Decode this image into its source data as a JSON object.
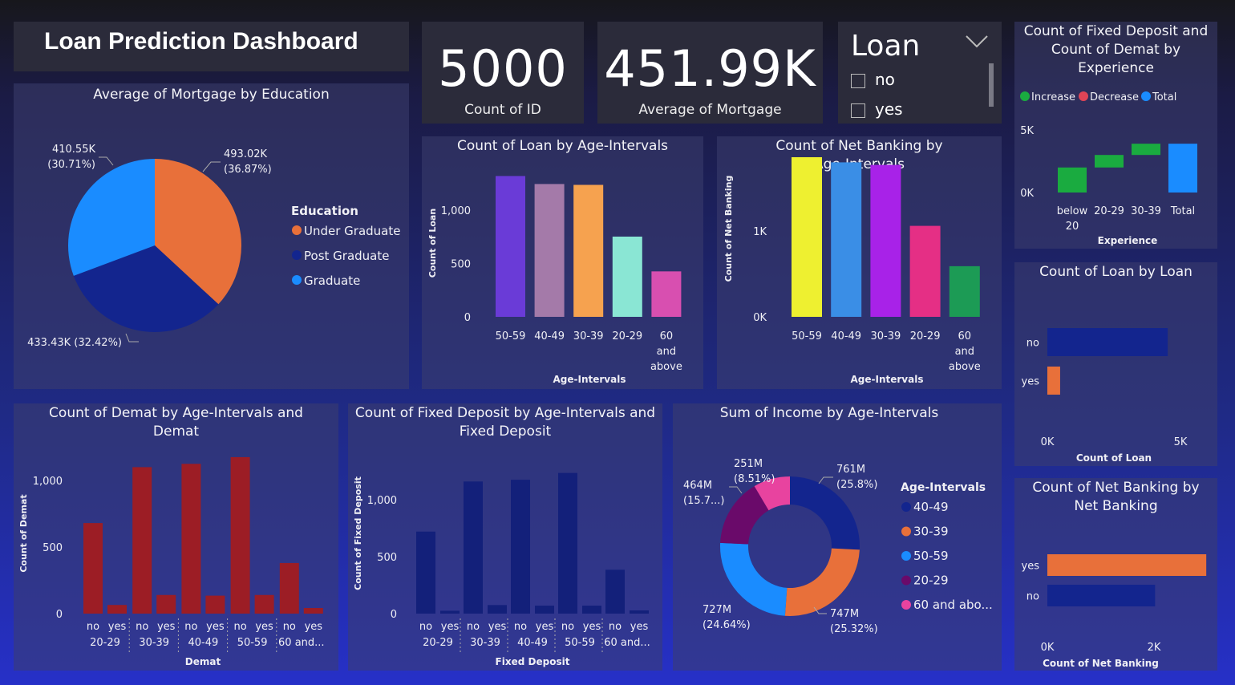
{
  "title": "Loan Prediction Dashboard",
  "cards": [
    {
      "value": "5000",
      "label": "Count of ID"
    },
    {
      "value": "451.99K",
      "label": "Average of Mortgage"
    }
  ],
  "slicer": {
    "title": "Loan",
    "options": [
      "no",
      "yes"
    ]
  },
  "colors": {
    "orange": "#e8703a",
    "navy": "#13258e",
    "blue": "#1a8cff",
    "darkred": "#9c1d25",
    "green": "#1aab40",
    "purple": "#6a0a6a",
    "pink": "#e8439f"
  },
  "icons": {
    "dropdown": "chevron-down-icon"
  },
  "mortgage_pie": {
    "title": "Average of Mortgage by Education",
    "legend_title": "Education",
    "labels": [
      "493.02K\n(36.87%)",
      "433.43K (32.42%)",
      "410.55K\n(30.71%)"
    ],
    "chart_data": {
      "type": "pie",
      "categories": [
        "Under Graduate",
        "Post Graduate",
        "Graduate"
      ],
      "values": [
        493.02,
        433.43,
        410.55
      ],
      "percent": [
        36.87,
        32.42,
        30.71
      ],
      "legend": [
        "Under Graduate",
        "Post Graduate",
        "Graduate"
      ],
      "colors": [
        "#e8703a",
        "#13258e",
        "#1a8cff"
      ]
    }
  },
  "loan_age": {
    "title": "Count of Loan by Age-Intervals",
    "chart_data": {
      "type": "bar",
      "categories": [
        "50-59",
        "40-49",
        "30-39",
        "20-29",
        "60 and above"
      ],
      "values": [
        1320,
        1245,
        1237,
        752,
        426
      ],
      "xlabel": "Age-Intervals",
      "ylabel": "Count of Loan",
      "yticks": [
        "0",
        "500",
        "1,000"
      ],
      "ylim": [
        0,
        1000
      ],
      "colors": [
        "#6a3bd7",
        "#a47aa9",
        "#f6a24f",
        "#8ae6d4",
        "#d84fb0"
      ]
    }
  },
  "netbank_age": {
    "title": "Count of Net Banking by Age-Intervals",
    "chart_data": {
      "type": "bar",
      "categories": [
        "50-59",
        "40-49",
        "30-39",
        "20-29",
        "60 and above"
      ],
      "values": [
        1860,
        1800,
        1770,
        1060,
        590
      ],
      "xlabel": "Age-Intervals",
      "ylabel": "Count of Net Banking",
      "yticks": [
        "0K",
        "1K"
      ],
      "ylim": [
        0,
        1000
      ],
      "colors": [
        "#eef030",
        "#3a8ee6",
        "#a822e8",
        "#e52f85",
        "#1c9b55"
      ]
    }
  },
  "waterfall": {
    "title": "Count of Fixed Deposit and Count of Demat by Experience",
    "legend": [
      "Increase",
      "Decrease",
      "Total"
    ],
    "legend_colors": [
      "#1aab40",
      "#e04456",
      "#1a8cff"
    ],
    "chart_data": {
      "type": "bar",
      "categories": [
        "below 20",
        "20-29",
        "30-39",
        "Total"
      ],
      "values": [
        2000,
        1000,
        900,
        3900
      ],
      "xlabel": "Experience",
      "yticks": [
        "0K",
        "5K"
      ],
      "ylim": [
        0,
        5000
      ]
    }
  },
  "loan_loan": {
    "title": "Count of Loan by Loan",
    "chart_data": {
      "type": "bar",
      "categories": [
        "no",
        "yes"
      ],
      "values": [
        4520,
        480
      ],
      "xlabel": "Count of Loan",
      "xticks": [
        "0K",
        "5K"
      ],
      "xlim": [
        0,
        5000
      ],
      "colors": [
        "#13258e",
        "#e8703a"
      ]
    }
  },
  "netbank_nb": {
    "title": "Count of Net Banking by Net Banking",
    "chart_data": {
      "type": "bar",
      "categories": [
        "yes",
        "no"
      ],
      "values": [
        2980,
        2020
      ],
      "xlabel": "Count of Net Banking",
      "xticks": [
        "0K",
        "2K"
      ],
      "xlim": [
        0,
        2000
      ],
      "colors": [
        "#e8703a",
        "#13258e"
      ]
    }
  },
  "demat": {
    "title": "Count of Demat by Age-Intervals and Demat",
    "chart_data": {
      "type": "bar",
      "categories": [
        "20-29",
        "30-39",
        "40-49",
        "50-59",
        "60 and..."
      ],
      "subcategories": [
        "no",
        "yes"
      ],
      "series": [
        {
          "name": "no",
          "values": [
            680,
            1100,
            1125,
            1175,
            380
          ]
        },
        {
          "name": "yes",
          "values": [
            65,
            140,
            135,
            140,
            42
          ]
        }
      ],
      "xlabel": "Demat",
      "ylabel": "Count of Demat",
      "yticks": [
        "0",
        "500",
        "1,000"
      ],
      "ylim": [
        0,
        1000
      ],
      "color": "#9c1d25"
    }
  },
  "fixed_deposit": {
    "title": "Count of Fixed Deposit by Age-Intervals and Fixed Deposit",
    "chart_data": {
      "type": "bar",
      "categories": [
        "20-29",
        "30-39",
        "40-49",
        "50-59",
        "60 and..."
      ],
      "subcategories": [
        "no",
        "yes"
      ],
      "series": [
        {
          "name": "no",
          "values": [
            720,
            1160,
            1175,
            1235,
            385
          ]
        },
        {
          "name": "yes",
          "values": [
            25,
            75,
            70,
            70,
            28
          ]
        }
      ],
      "xlabel": "Fixed Deposit",
      "ylabel": "Count of Fixed Deposit",
      "yticks": [
        "0",
        "500",
        "1,000"
      ],
      "ylim": [
        0,
        1000
      ],
      "color": "#13207a"
    }
  },
  "income": {
    "title": "Sum of Income by Age-Intervals",
    "legend_title": "Age-Intervals",
    "labels": [
      "761M\n(25.8%)",
      "747M\n(25.32%)",
      "727M\n(24.64%)",
      "464M\n(15.7...)",
      "251M\n(8.51%)"
    ],
    "chart_data": {
      "type": "pie",
      "categories": [
        "40-49",
        "30-39",
        "50-59",
        "20-29",
        "60 and abo..."
      ],
      "values": [
        761,
        747,
        727,
        464,
        251
      ],
      "percent": [
        25.8,
        25.32,
        24.64,
        15.7,
        8.51
      ],
      "legend": [
        "40-49",
        "30-39",
        "50-59",
        "20-29",
        "60 and abo..."
      ],
      "colors": [
        "#13258e",
        "#e8703a",
        "#1a8cff",
        "#6a0a6a",
        "#e8439f"
      ]
    }
  }
}
